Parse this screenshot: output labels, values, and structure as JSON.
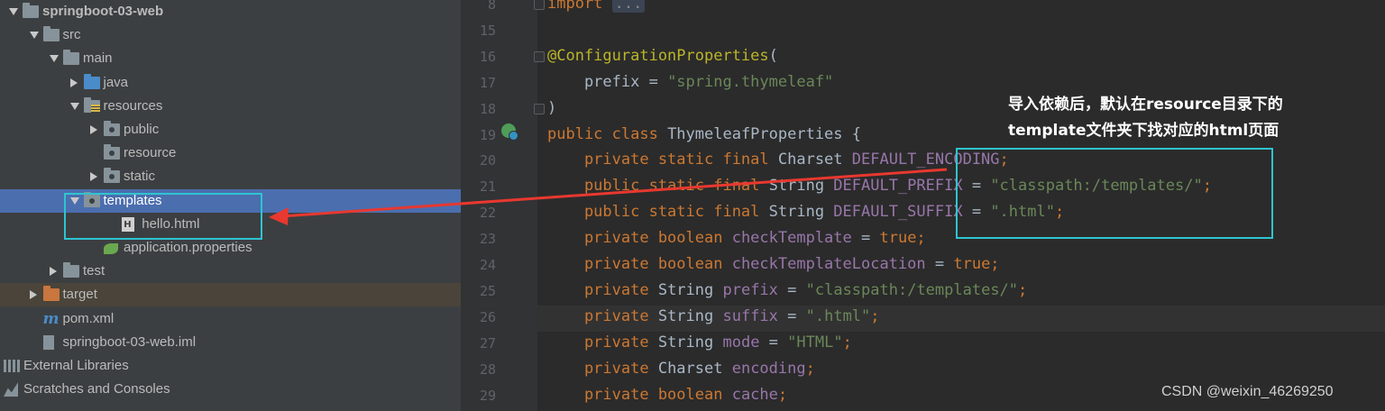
{
  "project_tree": {
    "items": [
      {
        "label": "springboot-03-web",
        "icon": "project-folder-icon",
        "expanded": true
      },
      {
        "label": "src",
        "icon": "folder-icon",
        "expanded": true
      },
      {
        "label": "main",
        "icon": "folder-icon",
        "expanded": true
      },
      {
        "label": "java",
        "icon": "source-folder-icon",
        "expanded": false
      },
      {
        "label": "resources",
        "icon": "resources-folder-icon",
        "expanded": true
      },
      {
        "label": "public",
        "icon": "folder-icon",
        "expanded": false
      },
      {
        "label": "resource",
        "icon": "folder-icon"
      },
      {
        "label": "static",
        "icon": "folder-icon",
        "expanded": false
      },
      {
        "label": "templates",
        "icon": "folder-icon",
        "expanded": true,
        "selected": true
      },
      {
        "label": "hello.html",
        "icon": "html-file-icon"
      },
      {
        "label": "application.properties",
        "icon": "spring-properties-icon"
      },
      {
        "label": "test",
        "icon": "folder-icon",
        "expanded": false
      },
      {
        "label": "target",
        "icon": "excluded-folder-icon",
        "expanded": false
      },
      {
        "label": "pom.xml",
        "icon": "maven-icon"
      },
      {
        "label": "springboot-03-web.iml",
        "icon": "iml-file-icon"
      },
      {
        "label": "External Libraries",
        "icon": "libraries-icon"
      },
      {
        "label": "Scratches and Consoles",
        "icon": "scratches-icon"
      }
    ]
  },
  "editor": {
    "current_line": "26",
    "lines": [
      {
        "num": "8",
        "segs": [
          [
            "kw",
            "import "
          ],
          [
            "collapsed",
            "..."
          ]
        ]
      },
      {
        "num": "15",
        "segs": []
      },
      {
        "num": "16",
        "segs": [
          [
            "anno",
            "@ConfigurationProperties"
          ],
          [
            "plain",
            "("
          ]
        ]
      },
      {
        "num": "17",
        "segs": [
          [
            "plain",
            "    prefix = "
          ],
          [
            "str",
            "\"spring.thymeleaf\""
          ]
        ]
      },
      {
        "num": "18",
        "segs": [
          [
            "plain",
            ")"
          ]
        ]
      },
      {
        "num": "19",
        "segs": [
          [
            "kw",
            "public class "
          ],
          [
            "plain",
            "ThymeleafProperties {"
          ]
        ]
      },
      {
        "num": "20",
        "segs": [
          [
            "kw",
            "    private static final "
          ],
          [
            "plain",
            "Charset "
          ],
          [
            "fld",
            "DEFAULT_ENCODING"
          ],
          [
            "kw",
            ";"
          ]
        ]
      },
      {
        "num": "21",
        "segs": [
          [
            "kw",
            "    public static final "
          ],
          [
            "plain",
            "String "
          ],
          [
            "fld",
            "DEFAULT_PREFIX"
          ],
          [
            "plain",
            " = "
          ],
          [
            "str",
            "\"classpath:/templates/\""
          ],
          [
            "kw",
            ";"
          ]
        ]
      },
      {
        "num": "22",
        "segs": [
          [
            "kw",
            "    public static final "
          ],
          [
            "plain",
            "String "
          ],
          [
            "fld",
            "DEFAULT_SUFFIX"
          ],
          [
            "plain",
            " = "
          ],
          [
            "str",
            "\".html\""
          ],
          [
            "kw",
            ";"
          ]
        ]
      },
      {
        "num": "23",
        "segs": [
          [
            "kw",
            "    private boolean "
          ],
          [
            "fld",
            "checkTemplate"
          ],
          [
            "plain",
            " = "
          ],
          [
            "kw",
            "true;"
          ]
        ]
      },
      {
        "num": "24",
        "segs": [
          [
            "kw",
            "    private boolean "
          ],
          [
            "fld",
            "checkTemplateLocation"
          ],
          [
            "plain",
            " = "
          ],
          [
            "kw",
            "true;"
          ]
        ]
      },
      {
        "num": "25",
        "segs": [
          [
            "kw",
            "    private "
          ],
          [
            "plain",
            "String "
          ],
          [
            "fld",
            "prefix"
          ],
          [
            "plain",
            " = "
          ],
          [
            "str",
            "\"classpath:/templates/\""
          ],
          [
            "kw",
            ";"
          ]
        ]
      },
      {
        "num": "26",
        "segs": [
          [
            "kw",
            "    private "
          ],
          [
            "plain",
            "String "
          ],
          [
            "fld",
            "suffix"
          ],
          [
            "plain",
            " = "
          ],
          [
            "str",
            "\".html\""
          ],
          [
            "kw",
            ";"
          ]
        ]
      },
      {
        "num": "27",
        "segs": [
          [
            "kw",
            "    private "
          ],
          [
            "plain",
            "String "
          ],
          [
            "fld",
            "mode"
          ],
          [
            "plain",
            " = "
          ],
          [
            "str",
            "\"HTML\""
          ],
          [
            "kw",
            ";"
          ]
        ]
      },
      {
        "num": "28",
        "segs": [
          [
            "kw",
            "    private "
          ],
          [
            "plain",
            "Charset "
          ],
          [
            "fld",
            "encoding"
          ],
          [
            "kw",
            ";"
          ]
        ]
      },
      {
        "num": "29",
        "segs": [
          [
            "kw",
            "    private boolean "
          ],
          [
            "fld",
            "cache"
          ],
          [
            "kw",
            ";"
          ]
        ]
      }
    ]
  },
  "annotation": {
    "line1": "导入依赖后，默认在resource目录下的",
    "line2": "template文件夹下找对应的html页面",
    "color": "#2fc4d0",
    "arrow_color": "#e8382f"
  },
  "watermark": "CSDN @weixin_46269250"
}
